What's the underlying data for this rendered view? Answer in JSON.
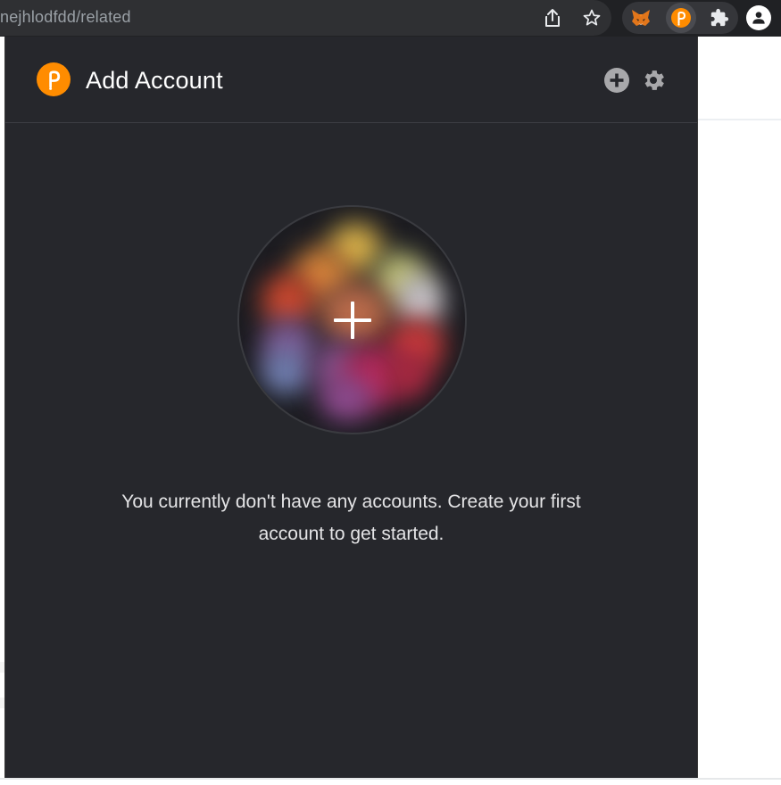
{
  "browser": {
    "url": "nejhlodfdd/related",
    "toolbar_icons": [
      "share-icon",
      "bookmark-star-icon"
    ],
    "extensions": [
      "metamask-fox-icon",
      "polkadot-extension-icon",
      "puzzle-icon",
      "profile-icon"
    ]
  },
  "popup": {
    "header": {
      "title": "Add Account",
      "logo": "polkadot-logo-icon",
      "actions": [
        "add-circle-icon",
        "settings-gear-icon"
      ]
    },
    "empty_state": {
      "identicon": "blurred-identicon",
      "action_icon": "plus-icon",
      "message": "You currently don't have any accounts. Create your first account to get started."
    }
  },
  "colors": {
    "popup_bg": "#26272c",
    "accent": "#ff8c00",
    "text": "#ffffff",
    "toolbar_bg": "#202124"
  }
}
